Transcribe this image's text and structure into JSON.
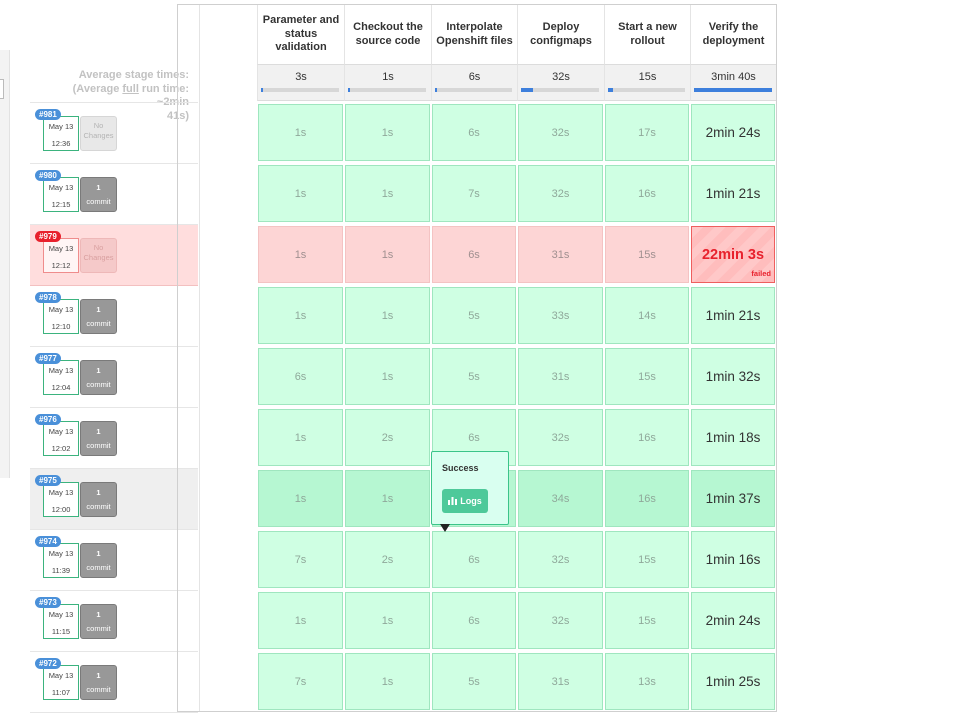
{
  "average_label": {
    "line1": "Average stage times:",
    "line2_pre": "(Average ",
    "line2_u": "full",
    "line2_post": " run time: ~2min",
    "line3": "41s)"
  },
  "stages": [
    {
      "name": "Parameter and status validation",
      "avg": "3s",
      "avg_fraction": 0.01
    },
    {
      "name": "Checkout the source code",
      "avg": "1s",
      "avg_fraction": 0.01
    },
    {
      "name": "Interpolate Openshift files",
      "avg": "6s",
      "avg_fraction": 0.03
    },
    {
      "name": "Deploy configmaps",
      "avg": "32s",
      "avg_fraction": 0.15
    },
    {
      "name": "Start a new rollout",
      "avg": "15s",
      "avg_fraction": 0.07
    },
    {
      "name": "Verify the deployment",
      "avg": "3min 40s",
      "avg_fraction": 1.0
    }
  ],
  "builds": [
    {
      "number": "#981",
      "date": "May 13",
      "time": "12:36",
      "changes_top": "No",
      "changes_bottom": "Changes",
      "kind": "nochange",
      "status": "success",
      "durations": [
        "1s",
        "1s",
        "6s",
        "32s",
        "17s",
        "2min 24s"
      ]
    },
    {
      "number": "#980",
      "date": "May 13",
      "time": "12:15",
      "changes_top": "1",
      "changes_bottom": "commit",
      "kind": "commit",
      "status": "success",
      "durations": [
        "1s",
        "1s",
        "7s",
        "32s",
        "16s",
        "1min 21s"
      ]
    },
    {
      "number": "#979",
      "date": "May 13",
      "time": "12:12",
      "changes_top": "No",
      "changes_bottom": "Changes",
      "kind": "nochange",
      "status": "failed",
      "failed_label": "failed",
      "durations": [
        "1s",
        "1s",
        "6s",
        "31s",
        "15s",
        "22min 3s"
      ]
    },
    {
      "number": "#978",
      "date": "May 13",
      "time": "12:10",
      "changes_top": "1",
      "changes_bottom": "commit",
      "kind": "commit",
      "status": "success",
      "durations": [
        "1s",
        "1s",
        "5s",
        "33s",
        "14s",
        "1min 21s"
      ]
    },
    {
      "number": "#977",
      "date": "May 13",
      "time": "12:04",
      "changes_top": "1",
      "changes_bottom": "commit",
      "kind": "commit",
      "status": "success",
      "durations": [
        "6s",
        "1s",
        "5s",
        "31s",
        "15s",
        "1min 32s"
      ]
    },
    {
      "number": "#976",
      "date": "May 13",
      "time": "12:02",
      "changes_top": "1",
      "changes_bottom": "commit",
      "kind": "commit",
      "status": "success",
      "durations": [
        "1s",
        "2s",
        "6s",
        "32s",
        "16s",
        "1min 18s"
      ]
    },
    {
      "number": "#975",
      "date": "May 13",
      "time": "12:00",
      "changes_top": "1",
      "changes_bottom": "commit",
      "kind": "commit",
      "status": "success",
      "hover": true,
      "durations": [
        "1s",
        "1s",
        "",
        "34s",
        "16s",
        "1min 37s"
      ]
    },
    {
      "number": "#974",
      "date": "May 13",
      "time": "11:39",
      "changes_top": "1",
      "changes_bottom": "commit",
      "kind": "commit",
      "status": "success",
      "durations": [
        "7s",
        "2s",
        "6s",
        "32s",
        "15s",
        "1min 16s"
      ]
    },
    {
      "number": "#973",
      "date": "May 13",
      "time": "11:15",
      "changes_top": "1",
      "changes_bottom": "commit",
      "kind": "commit",
      "status": "success",
      "durations": [
        "1s",
        "1s",
        "6s",
        "32s",
        "15s",
        "2min 24s"
      ]
    },
    {
      "number": "#972",
      "date": "May 13",
      "time": "11:07",
      "changes_top": "1",
      "changes_bottom": "commit",
      "kind": "commit",
      "status": "success",
      "durations": [
        "7s",
        "1s",
        "5s",
        "31s",
        "13s",
        "1min 25s"
      ]
    }
  ],
  "popover": {
    "title": "Success",
    "button": "Logs",
    "icon": "bar-chart-icon"
  },
  "colors": {
    "success_cell": "#cfffe3",
    "failed_cell": "#fdd5d5",
    "failed_accent": "#e8212d",
    "progress": "#3d7fdc",
    "badge": "#4a90d9"
  }
}
